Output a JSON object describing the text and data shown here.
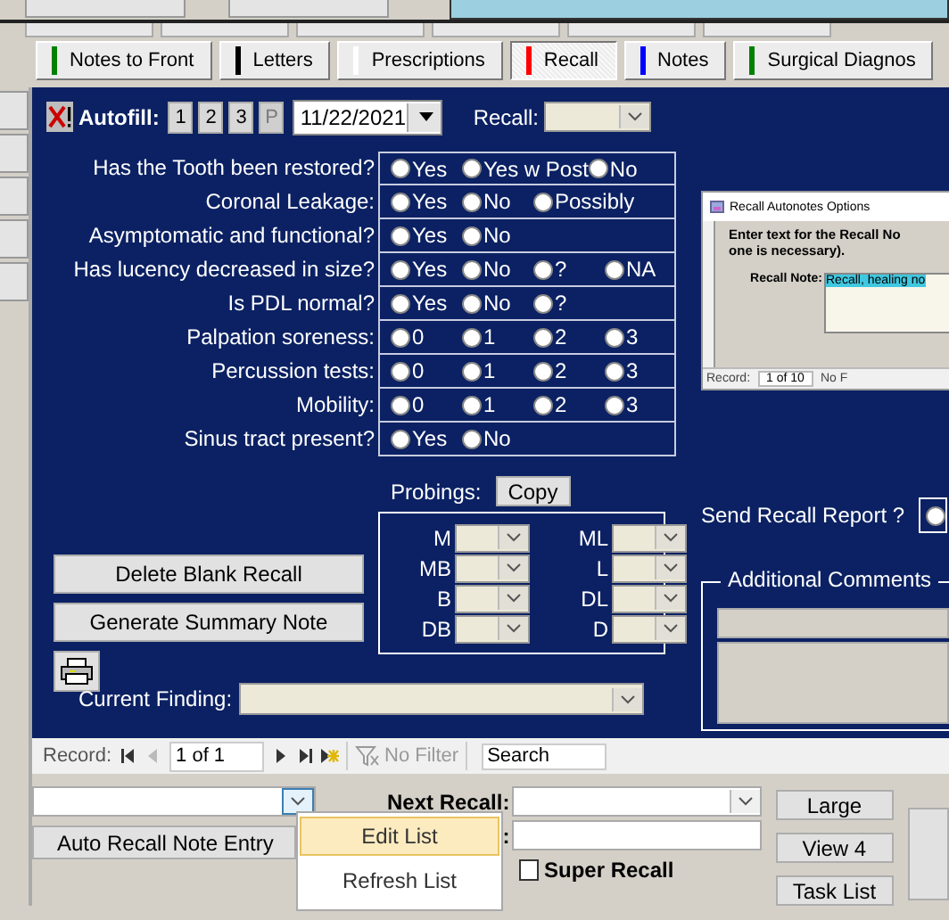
{
  "tabs": [
    {
      "label": "Notes to Front",
      "color": "#008000",
      "selected": false
    },
    {
      "label": "Letters",
      "color": "#000000",
      "selected": false
    },
    {
      "label": "Prescriptions",
      "color": "#ffffff",
      "selected": false
    },
    {
      "label": "Recall",
      "color": "#ff0000",
      "selected": true
    },
    {
      "label": "Notes",
      "color": "#0000ff",
      "selected": false
    },
    {
      "label": "Surgical Diagnos",
      "color": "#008000",
      "selected": false
    }
  ],
  "autofill": {
    "label": "Autofill:",
    "buttons": [
      {
        "label": "1",
        "disabled": false
      },
      {
        "label": "2",
        "disabled": false
      },
      {
        "label": "3",
        "disabled": false
      },
      {
        "label": "P",
        "disabled": true
      }
    ],
    "date": "11/22/2021",
    "recall_label": "Recall:"
  },
  "questions": [
    {
      "label": "Has the Tooth been restored?",
      "options": [
        {
          "label": "Yes",
          "selected": false
        },
        {
          "label": "Yes w Post",
          "selected": false
        },
        {
          "label": "No",
          "selected": false
        }
      ]
    },
    {
      "label": "Coronal Leakage:",
      "options": [
        {
          "label": "Yes",
          "selected": false
        },
        {
          "label": "No",
          "selected": false
        },
        {
          "label": "Possibly",
          "selected": false
        }
      ]
    },
    {
      "label": "Asymptomatic and functional?",
      "options": [
        {
          "label": "Yes",
          "selected": false
        },
        {
          "label": "No",
          "selected": false
        }
      ]
    },
    {
      "label": "Has lucency decreased in size?",
      "options": [
        {
          "label": "Yes",
          "selected": false
        },
        {
          "label": "No",
          "selected": false
        },
        {
          "label": "?",
          "selected": false
        },
        {
          "label": "NA",
          "selected": false
        }
      ]
    },
    {
      "label": "Is PDL normal?",
      "options": [
        {
          "label": "Yes",
          "selected": false
        },
        {
          "label": "No",
          "selected": false
        },
        {
          "label": "?",
          "selected": false
        }
      ]
    },
    {
      "label": "Palpation soreness:",
      "options": [
        {
          "label": "0",
          "selected": false
        },
        {
          "label": "1",
          "selected": false
        },
        {
          "label": "2",
          "selected": false
        },
        {
          "label": "3",
          "selected": false
        }
      ]
    },
    {
      "label": "Percussion tests:",
      "options": [
        {
          "label": "0",
          "selected": false
        },
        {
          "label": "1",
          "selected": false
        },
        {
          "label": "2",
          "selected": false
        },
        {
          "label": "3",
          "selected": false
        }
      ]
    },
    {
      "label": "Mobility:",
      "options": [
        {
          "label": "0",
          "selected": false
        },
        {
          "label": "1",
          "selected": false
        },
        {
          "label": "2",
          "selected": false
        },
        {
          "label": "3",
          "selected": false
        }
      ]
    },
    {
      "label": "Sinus tract present?",
      "options": [
        {
          "label": "Yes",
          "selected": false
        },
        {
          "label": "No",
          "selected": false
        }
      ]
    }
  ],
  "probings": {
    "label": "Probings:",
    "copy_button": "Copy",
    "sites": [
      "M",
      "ML",
      "MB",
      "L",
      "B",
      "DL",
      "DB",
      "D"
    ]
  },
  "buttons": {
    "delete": "Delete Blank Recall",
    "summary": "Generate Summary Note"
  },
  "current_finding_label": "Current Finding:",
  "embedded_screenshot": {
    "title": "Recall Autonotes Options",
    "prompt_1": "Enter text for the Recall No",
    "prompt_2": "one is necessary).",
    "note_label": "Recall Note:",
    "note_value": "Recall, healing no",
    "record_label": "Record:",
    "record_position": "1 of 10",
    "filter": "No F"
  },
  "send_report_label": "Send Recall Report ?",
  "send_report_option": {
    "selected": false
  },
  "additional_comments_label": "Additional Comments",
  "record_nav": {
    "label": "Record:",
    "position": "1 of 1",
    "filter": "No Filter",
    "search_placeholder": "Search"
  },
  "bottom": {
    "auto_recall_button": "Auto Recall Note Entry",
    "next_recall_label": "Next Recall:",
    "second_label": ":",
    "super_recall": {
      "label": "Super Recall",
      "checked": false
    },
    "side_buttons": [
      "Large",
      "View 4",
      "Task List"
    ]
  },
  "context_menu": [
    {
      "label": "Edit List",
      "selected": true
    },
    {
      "label": "Refresh List",
      "selected": false
    }
  ]
}
